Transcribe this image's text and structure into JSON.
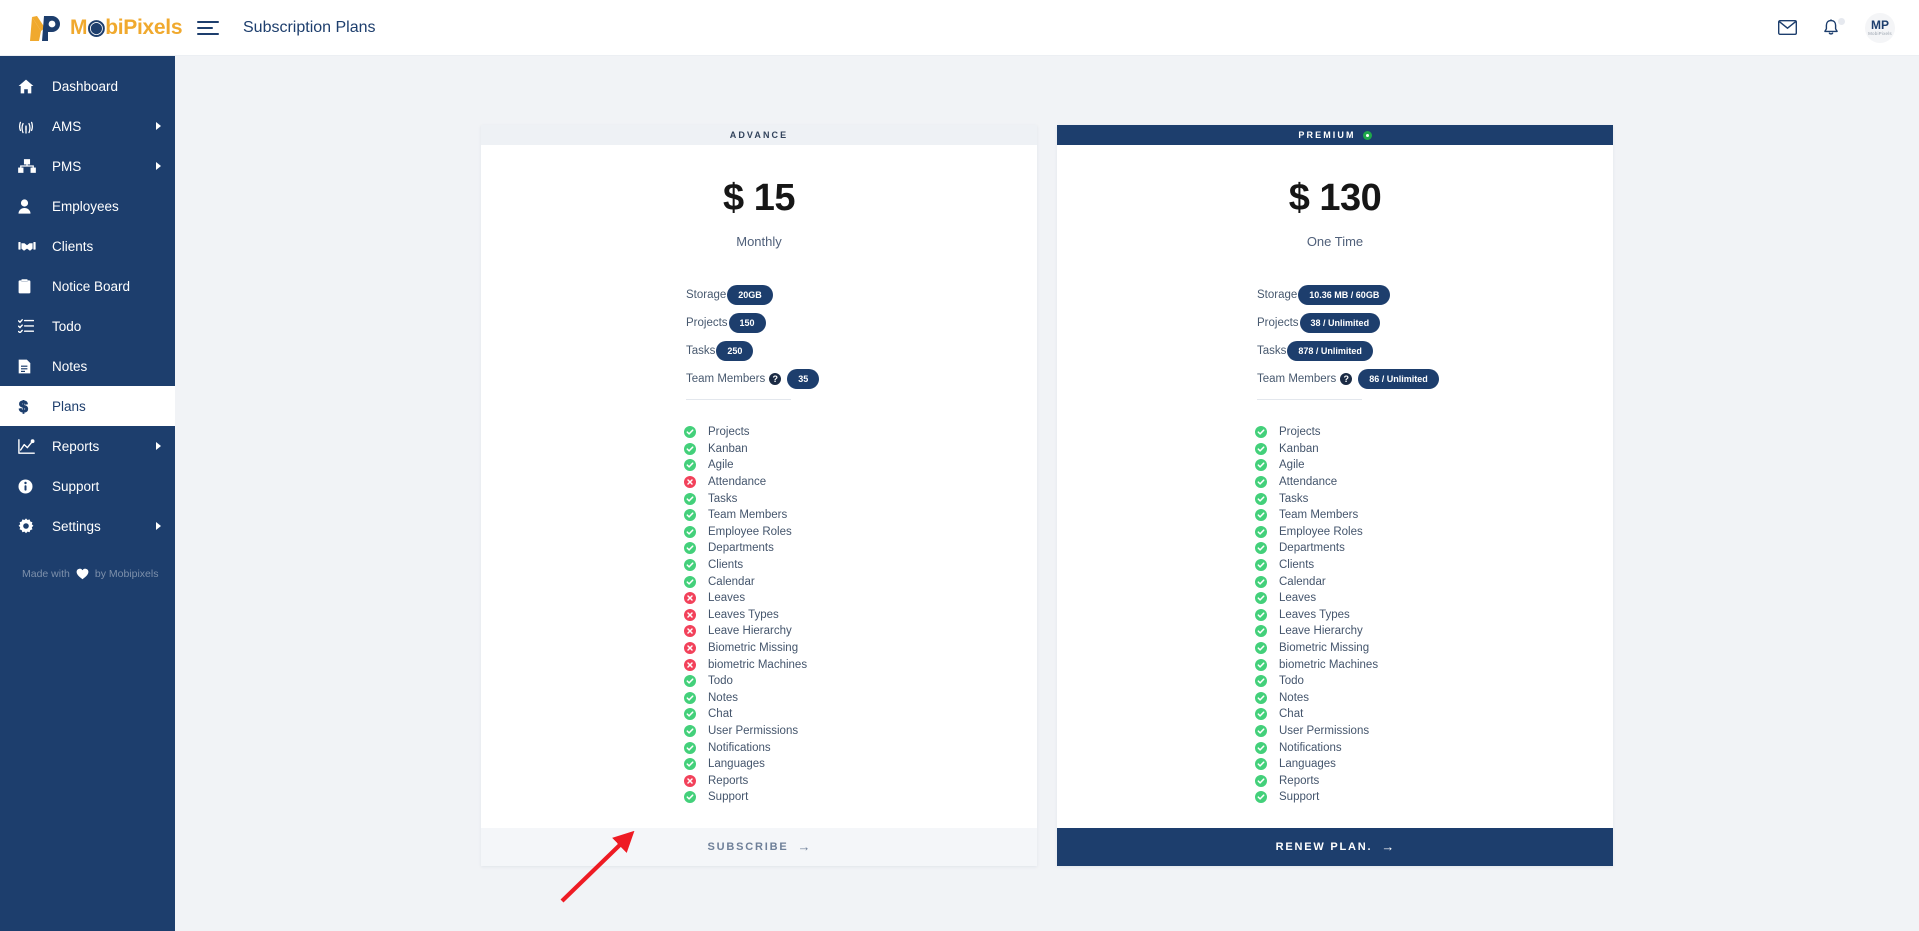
{
  "app": {
    "brand_name_part1": "M",
    "brand_name_part2": "biPixels",
    "page_title": "Subscription Plans"
  },
  "topbar": {
    "mail_icon": "envelope-icon",
    "bell_icon": "bell-icon",
    "avatar_initials": "M",
    "avatar_initials2": "P",
    "avatar_sub": "MobiPixels"
  },
  "sidebar": {
    "items": [
      {
        "label": "Dashboard",
        "icon": "home-icon",
        "expandable": false,
        "active": false
      },
      {
        "label": "AMS",
        "icon": "fingerprint-icon",
        "expandable": true,
        "active": false
      },
      {
        "label": "PMS",
        "icon": "project-icon",
        "expandable": true,
        "active": false
      },
      {
        "label": "Employees",
        "icon": "user-icon",
        "expandable": false,
        "active": false
      },
      {
        "label": "Clients",
        "icon": "handshake-icon",
        "expandable": false,
        "active": false
      },
      {
        "label": "Notice Board",
        "icon": "clipboard-icon",
        "expandable": false,
        "active": false
      },
      {
        "label": "Todo",
        "icon": "checklist-icon",
        "expandable": false,
        "active": false
      },
      {
        "label": "Notes",
        "icon": "note-icon",
        "expandable": false,
        "active": false
      },
      {
        "label": "Plans",
        "icon": "dollar-icon",
        "expandable": false,
        "active": true
      },
      {
        "label": "Reports",
        "icon": "chart-icon",
        "expandable": true,
        "active": false
      },
      {
        "label": "Support",
        "icon": "info-icon",
        "expandable": false,
        "active": false
      },
      {
        "label": "Settings",
        "icon": "gear-icon",
        "expandable": true,
        "active": false
      }
    ],
    "footer_prefix": "Made with",
    "footer_suffix": "by Mobipixels",
    "footer_icon": "heart-icon"
  },
  "plans": [
    {
      "name": "ADVANCE",
      "highlighted": false,
      "price": "$ 15",
      "period": "Monthly",
      "stats": [
        {
          "label": "Storage",
          "value": "20GB",
          "help": false
        },
        {
          "label": "Projects",
          "value": "150",
          "help": false
        },
        {
          "label": "Tasks",
          "value": "250",
          "help": false
        },
        {
          "label": "Team Members",
          "value": "35",
          "help": true
        }
      ],
      "features": [
        {
          "label": "Projects",
          "included": true
        },
        {
          "label": "Kanban",
          "included": true
        },
        {
          "label": "Agile",
          "included": true
        },
        {
          "label": "Attendance",
          "included": false
        },
        {
          "label": "Tasks",
          "included": true
        },
        {
          "label": "Team Members",
          "included": true
        },
        {
          "label": "Employee Roles",
          "included": true
        },
        {
          "label": "Departments",
          "included": true
        },
        {
          "label": "Clients",
          "included": true
        },
        {
          "label": "Calendar",
          "included": true
        },
        {
          "label": "Leaves",
          "included": false
        },
        {
          "label": "Leaves Types",
          "included": false
        },
        {
          "label": "Leave Hierarchy",
          "included": false
        },
        {
          "label": "Biometric Missing",
          "included": false
        },
        {
          "label": "biometric Machines",
          "included": false
        },
        {
          "label": "Todo",
          "included": true
        },
        {
          "label": "Notes",
          "included": true
        },
        {
          "label": "Chat",
          "included": true
        },
        {
          "label": "User Permissions",
          "included": true
        },
        {
          "label": "Notifications",
          "included": true
        },
        {
          "label": "Languages",
          "included": true
        },
        {
          "label": "Reports",
          "included": false
        },
        {
          "label": "Support",
          "included": true
        }
      ],
      "cta_label": "SUBSCRIBE",
      "cta_arrow": "→"
    },
    {
      "name": "PREMIUM",
      "highlighted": true,
      "price": "$ 130",
      "period": "One Time",
      "stats": [
        {
          "label": "Storage",
          "value": "10.36 MB / 60GB",
          "help": false
        },
        {
          "label": "Projects",
          "value": "38 / Unlimited",
          "help": false
        },
        {
          "label": "Tasks",
          "value": "878 / Unlimited",
          "help": false
        },
        {
          "label": "Team Members",
          "value": "86 / Unlimited",
          "help": true
        }
      ],
      "features": [
        {
          "label": "Projects",
          "included": true
        },
        {
          "label": "Kanban",
          "included": true
        },
        {
          "label": "Agile",
          "included": true
        },
        {
          "label": "Attendance",
          "included": true
        },
        {
          "label": "Tasks",
          "included": true
        },
        {
          "label": "Team Members",
          "included": true
        },
        {
          "label": "Employee Roles",
          "included": true
        },
        {
          "label": "Departments",
          "included": true
        },
        {
          "label": "Clients",
          "included": true
        },
        {
          "label": "Calendar",
          "included": true
        },
        {
          "label": "Leaves",
          "included": true
        },
        {
          "label": "Leaves Types",
          "included": true
        },
        {
          "label": "Leave Hierarchy",
          "included": true
        },
        {
          "label": "Biometric Missing",
          "included": true
        },
        {
          "label": "biometric Machines",
          "included": true
        },
        {
          "label": "Todo",
          "included": true
        },
        {
          "label": "Notes",
          "included": true
        },
        {
          "label": "Chat",
          "included": true
        },
        {
          "label": "User Permissions",
          "included": true
        },
        {
          "label": "Notifications",
          "included": true
        },
        {
          "label": "Languages",
          "included": true
        },
        {
          "label": "Reports",
          "included": true
        },
        {
          "label": "Support",
          "included": true
        }
      ],
      "cta_label": "RENEW PLAN.",
      "cta_arrow": "→"
    }
  ],
  "annotation": {
    "type": "red-arrow",
    "color": "#ee1b24",
    "points_to": "subscribe-button"
  },
  "colors": {
    "navy": "#1d3e6d",
    "accent_orange": "#f0a92e",
    "included_green": "#43d07a",
    "excluded_red": "#f2415a",
    "page_bg": "#f1f3f6"
  }
}
